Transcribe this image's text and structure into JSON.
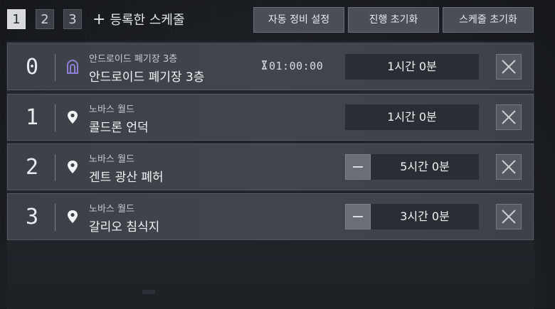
{
  "presets": [
    {
      "label": "1",
      "active": true
    },
    {
      "label": "2",
      "active": false
    },
    {
      "label": "3",
      "active": false
    }
  ],
  "header": {
    "plus": "+",
    "registered_label": "등록한 스케줄"
  },
  "toolbar": {
    "auto_repair": "자동 정비 설정",
    "reset_progress": "진행 초기화",
    "reset_schedule": "스케줄 초기화"
  },
  "schedule": [
    {
      "index": "0",
      "icon": "dungeon-gate-icon",
      "region": "안드로이드 폐기장 3층",
      "place": "안드로이드 폐기장 3층",
      "timer": "01:00:00",
      "duration": "1시간 0분",
      "has_minus": false
    },
    {
      "index": "1",
      "icon": "location-pin-icon",
      "region": "노바스 월드",
      "place": "콜드론 언덕",
      "timer": "",
      "duration": "1시간 0분",
      "has_minus": false
    },
    {
      "index": "2",
      "icon": "location-pin-icon",
      "region": "노바스 월드",
      "place": "겐트 광산 폐허",
      "timer": "",
      "duration": "5시간 0분",
      "has_minus": true
    },
    {
      "index": "3",
      "icon": "location-pin-icon",
      "region": "노바스 월드",
      "place": "갈리오 침식지",
      "timer": "",
      "duration": "3시간 0분",
      "has_minus": true
    }
  ],
  "colors": {
    "accent_icon": "#8f7fd8",
    "pin": "#f2f3f5"
  }
}
